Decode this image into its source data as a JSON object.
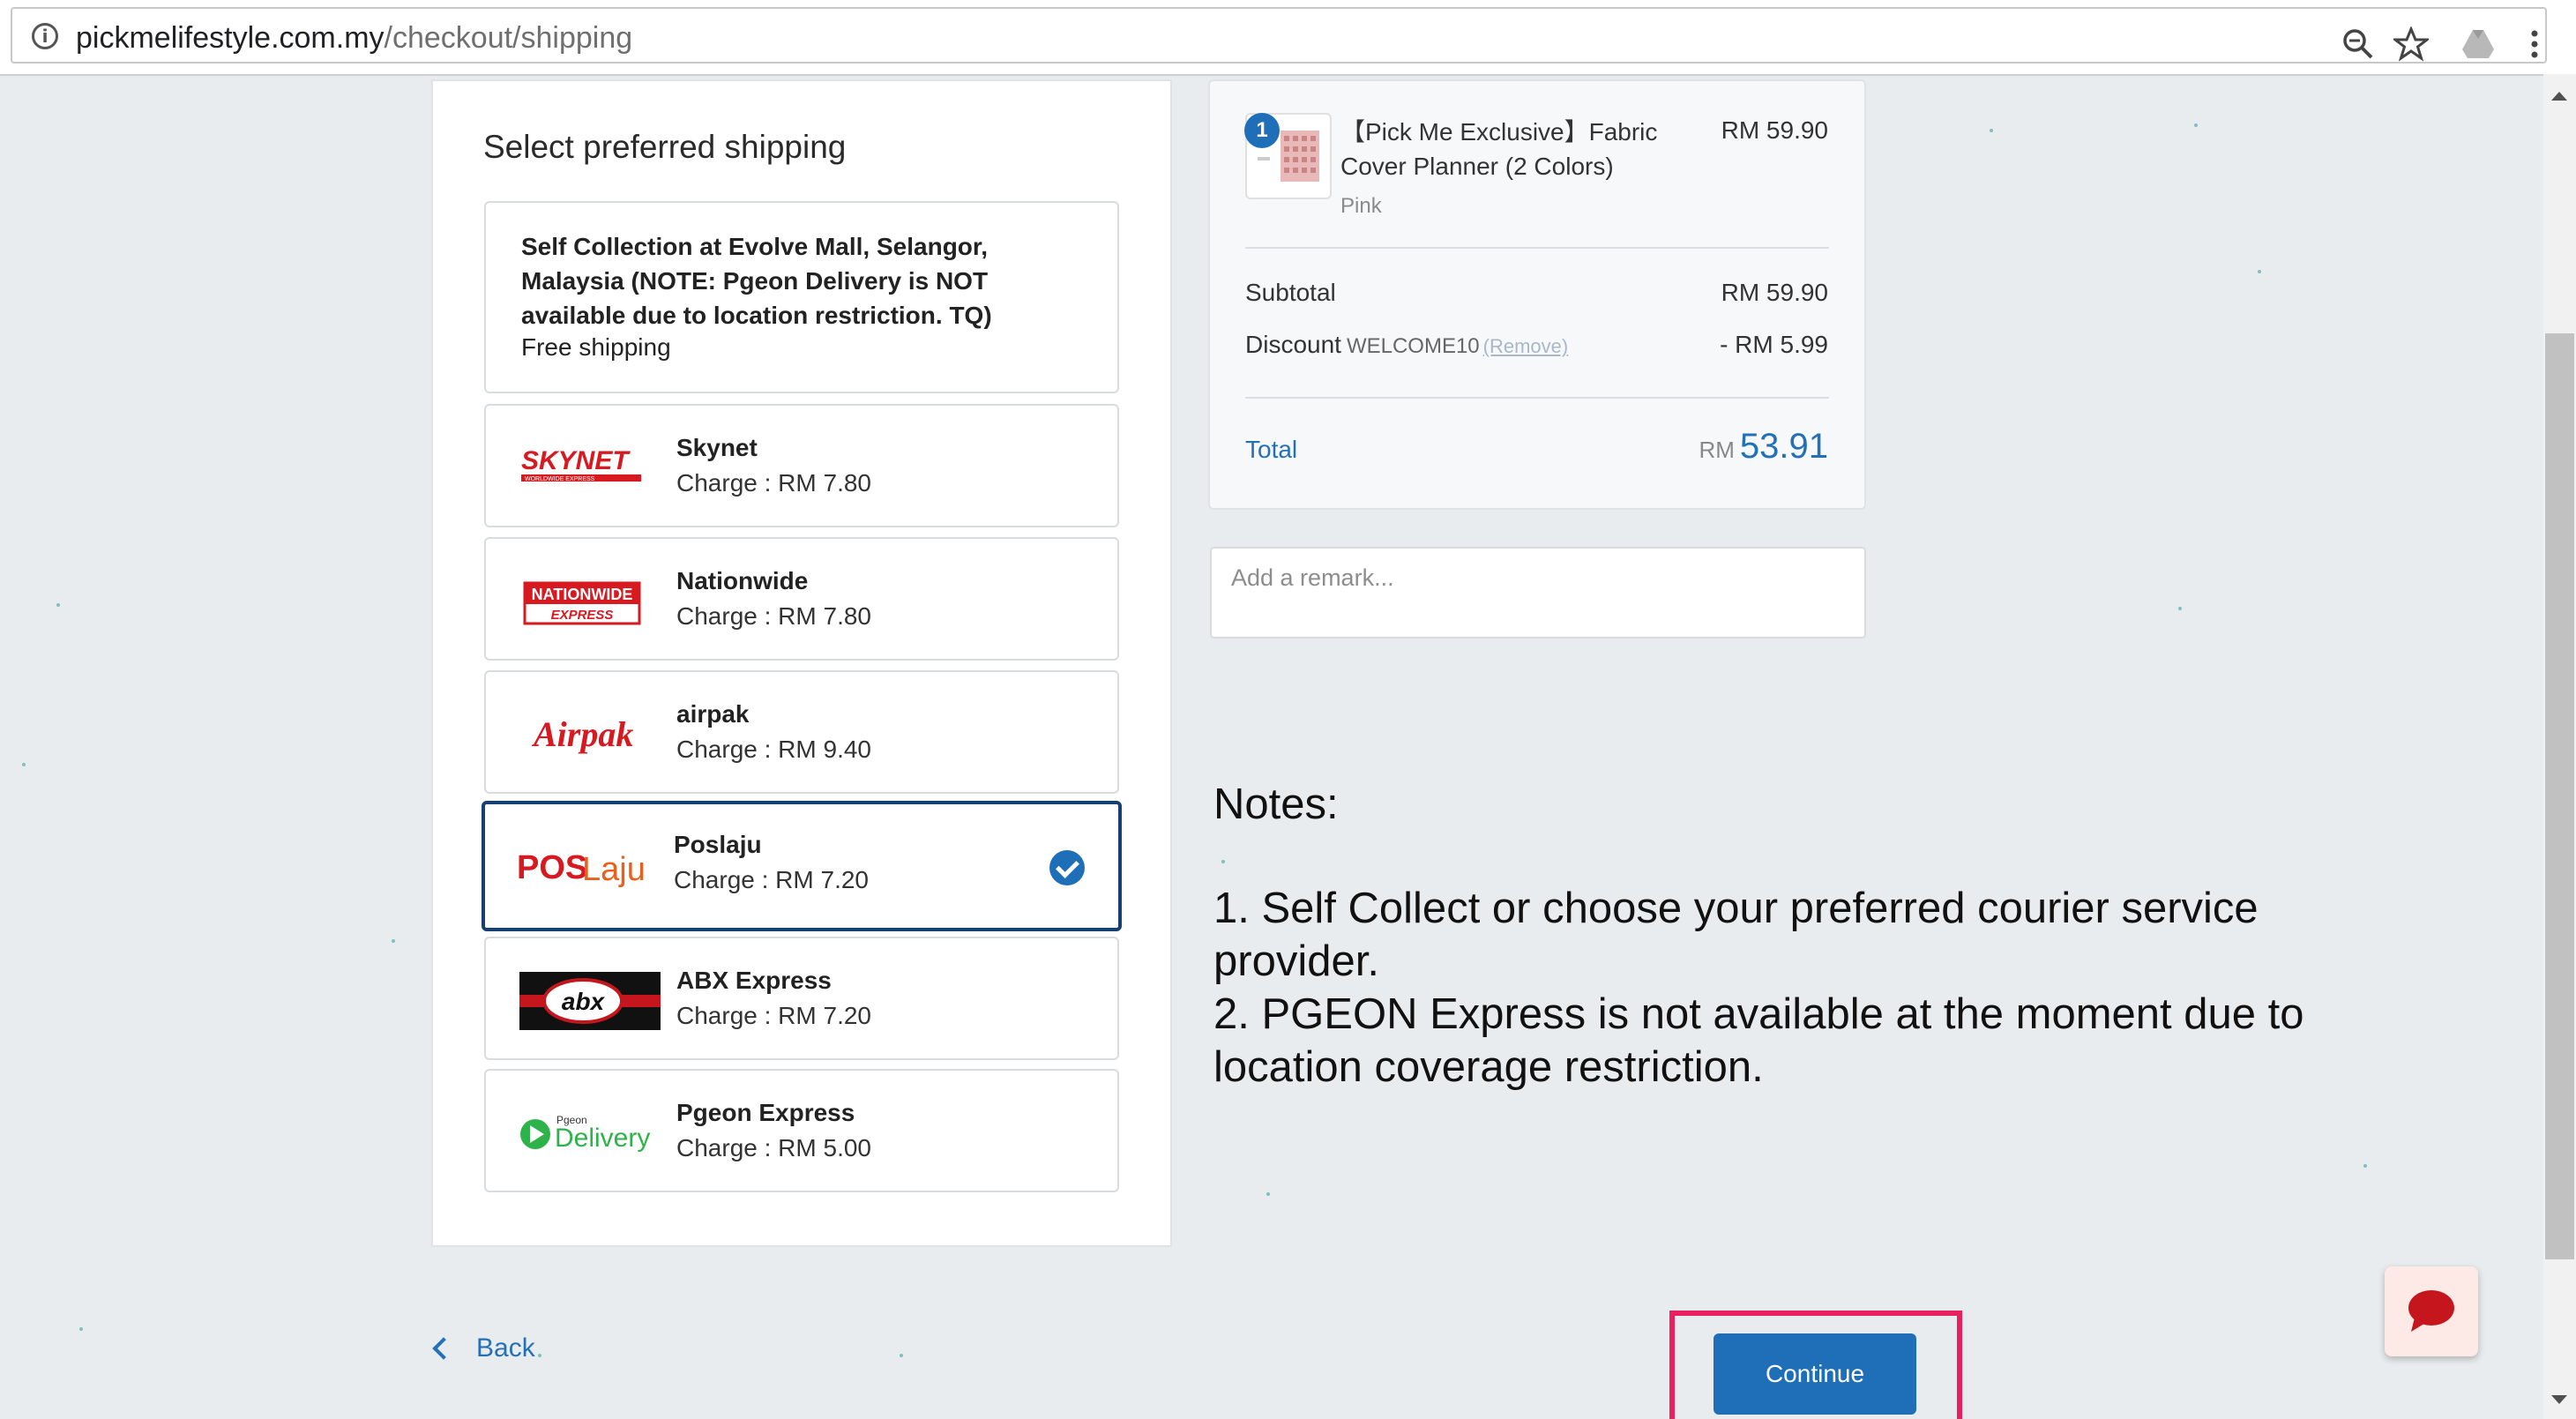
{
  "browser": {
    "url_domain": "pickmelifestyle.com.my",
    "url_path": "/checkout/shipping",
    "info_icon": "i"
  },
  "shipping": {
    "title": "Select preferred shipping",
    "options": [
      {
        "name": "Self Collection at Evolve Mall, Selangor, Malaysia (NOTE: Pgeon Delivery is NOT available due to location restriction. TQ)",
        "charge": "Free shipping",
        "icon": "none",
        "selected": false
      },
      {
        "name": "Skynet",
        "charge": "Charge : RM 7.80",
        "icon": "skynet-logo",
        "selected": false
      },
      {
        "name": "Nationwide",
        "charge": "Charge : RM 7.80",
        "icon": "nationwide-logo",
        "selected": false
      },
      {
        "name": "airpak",
        "charge": "Charge : RM 9.40",
        "icon": "airpak-logo",
        "selected": false
      },
      {
        "name": "Poslaju",
        "charge": "Charge : RM 7.20",
        "icon": "poslaju-logo",
        "selected": true
      },
      {
        "name": "ABX Express",
        "charge": "Charge : RM 7.20",
        "icon": "abx-logo",
        "selected": false
      },
      {
        "name": "Pgeon Express",
        "charge": "Charge : RM 5.00",
        "icon": "pgeon-delivery-logo",
        "selected": false
      }
    ],
    "logos": {
      "skynet": "SKYNET",
      "skynet_sub": "WORLDWIDE EXPRESS",
      "nationwide": "NATIONWIDE",
      "nationwide_sub": "EXPRESS",
      "airpak": "Airpak",
      "poslaju_a": "POS",
      "poslaju_b": "Laju",
      "abx": "abx",
      "pgeon_small": "Pgeon",
      "pgeon_big": "Delivery"
    }
  },
  "summary": {
    "item": {
      "qty": "1",
      "name": "【Pick Me Exclusive】Fabric Cover Planner (2 Colors)",
      "price": "RM 59.90",
      "variant": "Pink"
    },
    "subtotal_label": "Subtotal",
    "subtotal_value": "RM 59.90",
    "discount_label": "Discount",
    "discount_code": "WELCOME10",
    "discount_remove": "(Remove)",
    "discount_value": "- RM 5.99",
    "total_label": "Total",
    "total_currency": "RM",
    "total_value": "53.91",
    "remark_placeholder": "Add a remark..."
  },
  "notes": {
    "title": "Notes:",
    "line1": "1. Self Collect or choose your preferred courier service provider.",
    "line2": "2. PGEON Express is not available at the moment due to location coverage restriction."
  },
  "nav": {
    "back_label": "Back",
    "continue_label": "Continue"
  },
  "colors": {
    "accent": "#1f6fb8",
    "selected_border": "#163f73",
    "highlight": "#e8215e",
    "background": "#e9ecee"
  }
}
